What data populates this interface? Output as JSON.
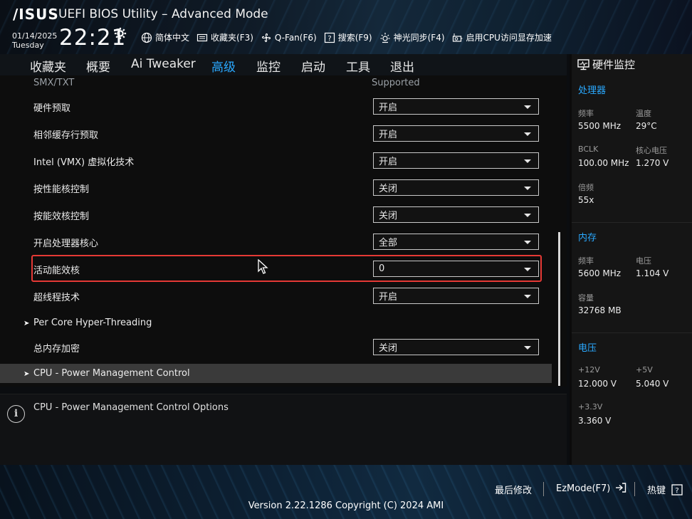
{
  "header": {
    "logo": "/ISUS",
    "title": "UEFI BIOS Utility – Advanced Mode",
    "date": "01/14/2025",
    "weekday": "Tuesday",
    "time": "22:21",
    "links": [
      {
        "icon": "globe-icon",
        "label": "简体中文"
      },
      {
        "icon": "folder-icon",
        "label": "收藏夹(F3)"
      },
      {
        "icon": "fan-icon",
        "label": "Q-Fan(F6)"
      },
      {
        "icon": "help-icon",
        "label": "搜索(F9)"
      },
      {
        "icon": "light-icon",
        "label": "神光同步(F4)"
      },
      {
        "icon": "gpu-icon",
        "label": "启用CPU访问显存加速"
      }
    ]
  },
  "nav": {
    "tabs": [
      "收藏夹",
      "概要",
      "Ai Tweaker",
      "高级",
      "监控",
      "启动",
      "工具",
      "退出"
    ],
    "active": "高级"
  },
  "settings": [
    {
      "label": "SMX/TXT",
      "value": "Supported",
      "type": "text"
    },
    {
      "label": "硬件预取",
      "value": "开启",
      "type": "dropdown"
    },
    {
      "label": "相邻缓存行预取",
      "value": "开启",
      "type": "dropdown"
    },
    {
      "label": "Intel (VMX) 虚拟化技术",
      "value": "开启",
      "type": "dropdown"
    },
    {
      "label": "按性能核控制",
      "value": "关闭",
      "type": "dropdown"
    },
    {
      "label": "按能效核控制",
      "value": "关闭",
      "type": "dropdown"
    },
    {
      "label": "开启处理器核心",
      "value": "全部",
      "type": "dropdown"
    },
    {
      "label": "活动能效核",
      "value": "0",
      "type": "dropdown"
    },
    {
      "label": "超线程技术",
      "value": "开启",
      "type": "dropdown"
    },
    {
      "label": "Per Core Hyper-Threading",
      "type": "submenu"
    },
    {
      "label": "总内存加密",
      "value": "关闭",
      "type": "dropdown"
    },
    {
      "label": "CPU - Power Management Control",
      "type": "submenu"
    }
  ],
  "info": {
    "text": "CPU - Power Management Control Options"
  },
  "monitor": {
    "title": "硬件监控",
    "cpu": {
      "title": "处理器",
      "freq_label": "频率",
      "freq": "5500 MHz",
      "temp_label": "温度",
      "temp": "29°C",
      "bclk_label": "BCLK",
      "bclk": "100.00 MHz",
      "vcore_label": "核心电压",
      "vcore": "1.270 V",
      "ratio_label": "倍频",
      "ratio": "55x"
    },
    "memory": {
      "title": "内存",
      "freq_label": "频率",
      "freq": "5600 MHz",
      "volt_label": "电压",
      "volt": "1.104 V",
      "cap_label": "容量",
      "cap": "32768 MB"
    },
    "voltage": {
      "title": "电压",
      "v12_label": "+12V",
      "v12": "12.000 V",
      "v5_label": "+5V",
      "v5": "5.040 V",
      "v33_label": "+3.3V",
      "v33": "3.360 V"
    }
  },
  "footer": {
    "last_modified": "最后修改",
    "ezmode": "EzMode(F7)",
    "hotkeys": "热键",
    "version": "Version 2.22.1286 Copyright (C) 2024 AMI"
  }
}
